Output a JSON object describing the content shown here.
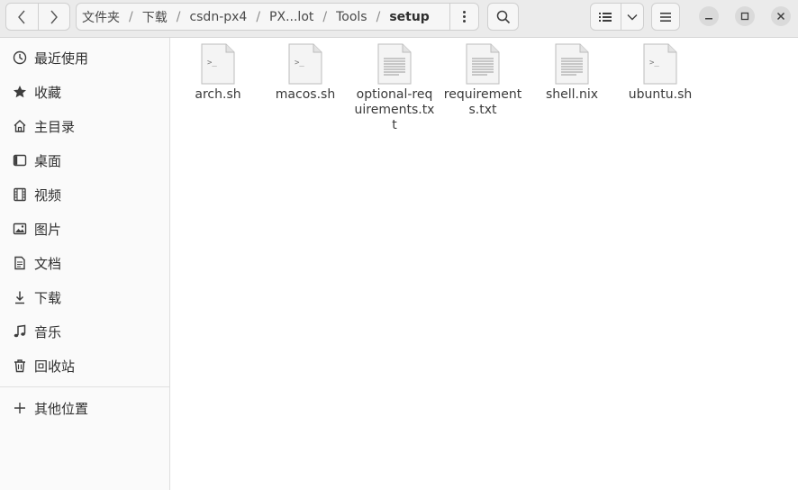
{
  "toolbar": {
    "back_icon": "chevron-left-icon",
    "forward_icon": "chevron-right-icon",
    "breadcrumbs": [
      {
        "label": "文件夹"
      },
      {
        "label": "下载"
      },
      {
        "label": "csdn-px4"
      },
      {
        "label": "PX...lot"
      },
      {
        "label": "Tools"
      },
      {
        "label": "setup"
      }
    ],
    "path_menu_icon": "kebab-menu-icon",
    "search_icon": "search-icon",
    "view_icon": "list-view-icon",
    "view_dropdown_icon": "chevron-down-icon",
    "main_menu_icon": "hamburger-menu-icon"
  },
  "window_controls": {
    "minimize_icon": "minimize-icon",
    "maximize_icon": "maximize-icon",
    "close_icon": "close-icon"
  },
  "sidebar": {
    "items": [
      {
        "label": "最近使用",
        "icon": "clock-icon"
      },
      {
        "label": "收藏",
        "icon": "star-icon"
      },
      {
        "label": "主目录",
        "icon": "home-icon"
      },
      {
        "label": "桌面",
        "icon": "desktop-icon"
      },
      {
        "label": "视频",
        "icon": "film-icon"
      },
      {
        "label": "图片",
        "icon": "image-icon"
      },
      {
        "label": "文档",
        "icon": "document-icon"
      },
      {
        "label": "下载",
        "icon": "download-icon"
      },
      {
        "label": "音乐",
        "icon": "music-icon"
      },
      {
        "label": "回收站",
        "icon": "trash-icon"
      }
    ],
    "other": {
      "label": "其他位置",
      "icon": "plus-icon"
    }
  },
  "files": [
    {
      "name": "arch.sh",
      "type": "script"
    },
    {
      "name": "macos.sh",
      "type": "script"
    },
    {
      "name": "optional-requirements.txt",
      "type": "text"
    },
    {
      "name": "requirements.txt",
      "type": "text"
    },
    {
      "name": "shell.nix",
      "type": "text"
    },
    {
      "name": "ubuntu.sh",
      "type": "script"
    }
  ],
  "colors": {
    "headerbar": "#ebebeb",
    "sidebar": "#fafafa",
    "content": "#ffffff"
  }
}
